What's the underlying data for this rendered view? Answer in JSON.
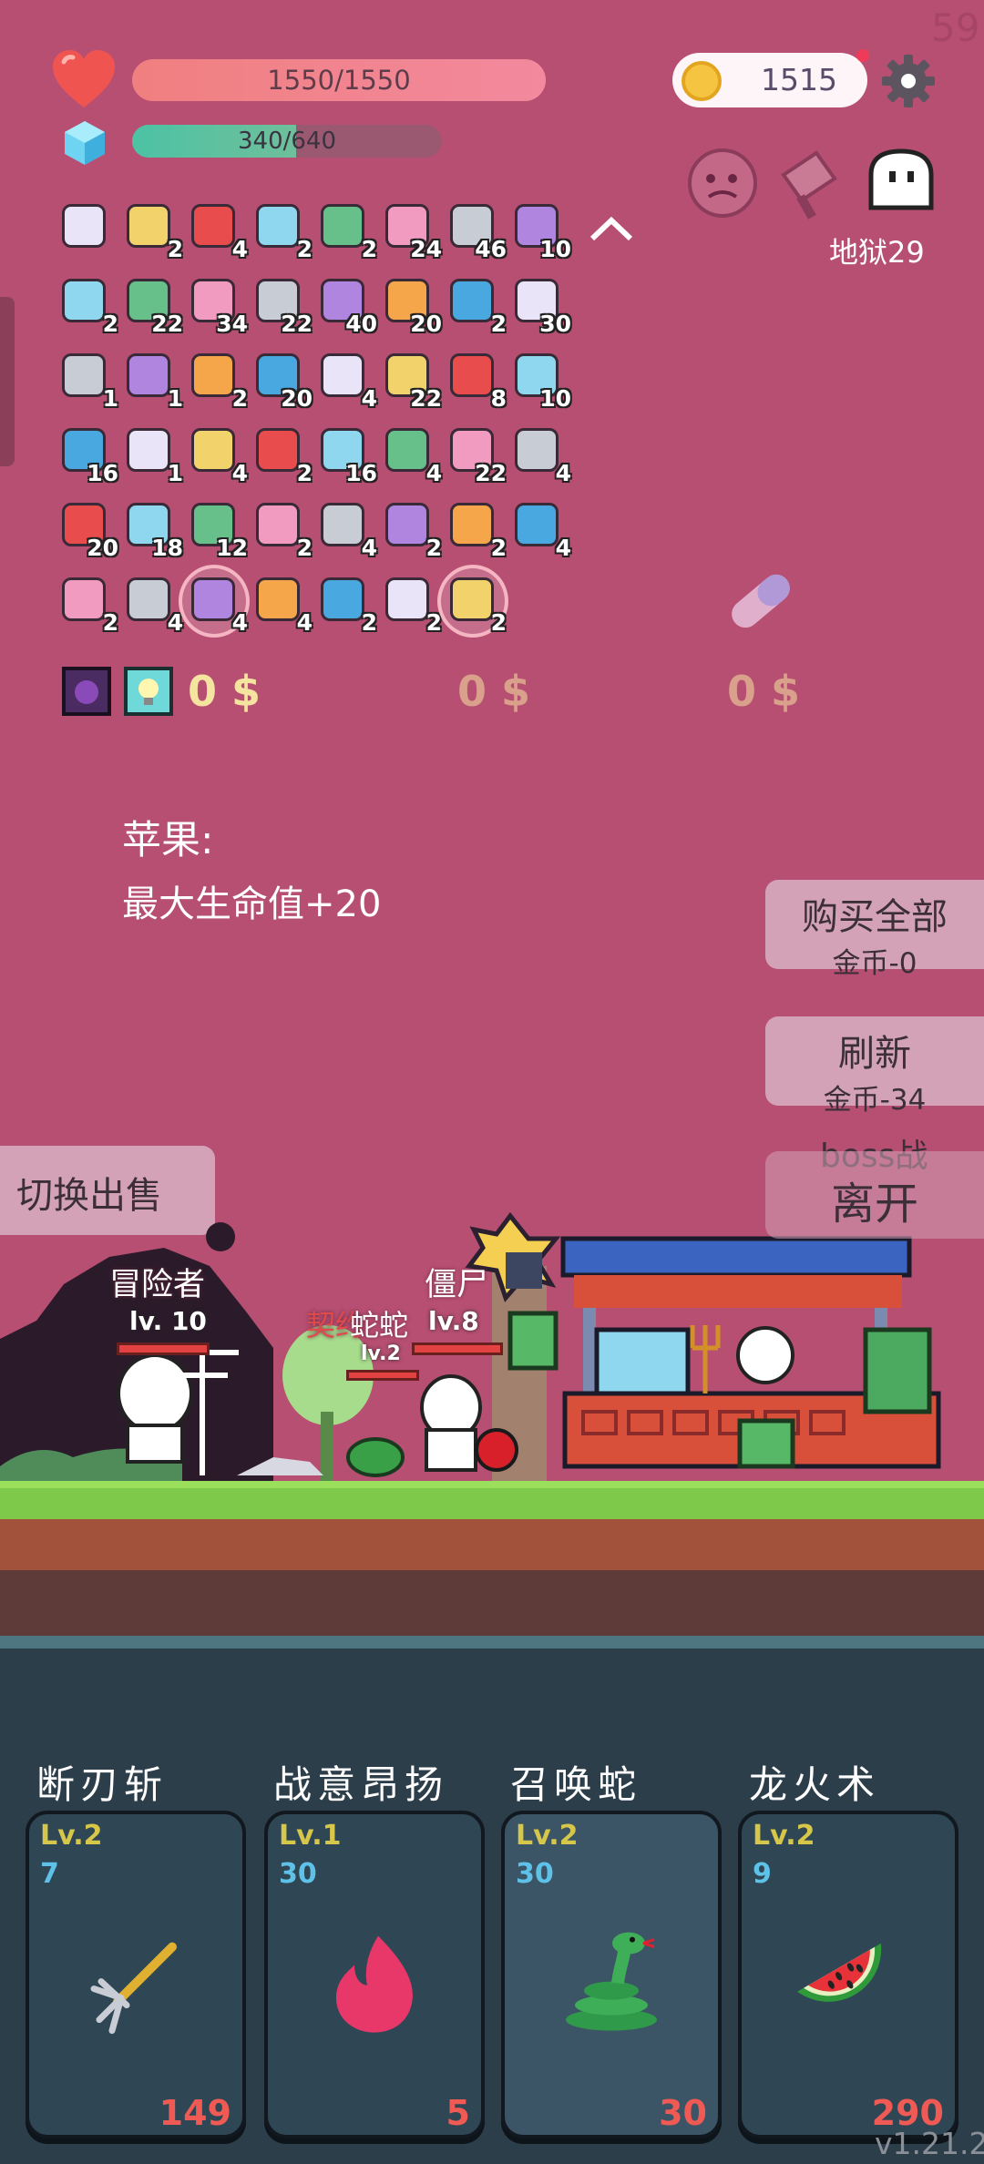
{
  "fps": "59",
  "hp": {
    "text": "1550/1550"
  },
  "mp": {
    "text": "340/640",
    "fraction": 0.53
  },
  "coins": {
    "amount": "1515"
  },
  "dungeon": {
    "label": "地狱29"
  },
  "inventory": [
    [
      {
        "icon": "tv-icon",
        "count": ""
      },
      {
        "icon": "tv-icon",
        "count": "2"
      },
      {
        "icon": "biohazard-icon",
        "count": "4"
      },
      {
        "icon": "tv-icon",
        "count": "2"
      },
      {
        "icon": "snake-icon",
        "count": "2"
      },
      {
        "icon": "beer-icon",
        "count": "24"
      },
      {
        "icon": "sword-icon",
        "count": "46"
      },
      {
        "icon": "dagger-icon",
        "count": "10"
      }
    ],
    [
      {
        "icon": "crystal-ball-icon",
        "count": "2"
      },
      {
        "icon": "shield-icon",
        "count": "22"
      },
      {
        "icon": "apple-icon",
        "count": "34"
      },
      {
        "icon": "thermometer-icon",
        "count": "22"
      },
      {
        "icon": "watermelon-icon",
        "count": "40"
      },
      {
        "icon": "potion-icon",
        "count": "20"
      },
      {
        "icon": "briefcase-icon",
        "count": "2"
      },
      {
        "icon": "book-icon",
        "count": "30"
      }
    ],
    [
      {
        "icon": "map-icon",
        "count": "1"
      },
      {
        "icon": "dice-icon",
        "count": "1"
      },
      {
        "icon": "ice-cream-icon",
        "count": "2"
      },
      {
        "icon": "pill-icon",
        "count": "20"
      },
      {
        "icon": "jam-icon",
        "count": "4"
      },
      {
        "icon": "capsule-icon",
        "count": "22"
      },
      {
        "icon": "tombstone-icon",
        "count": "8"
      },
      {
        "icon": "blade-icon",
        "count": "10"
      }
    ],
    [
      {
        "icon": "flower-icon",
        "count": "16"
      },
      {
        "icon": "treasure-map-icon",
        "count": "1"
      },
      {
        "icon": "egg-icon",
        "count": "4"
      },
      {
        "icon": "molecule-icon",
        "count": "2"
      },
      {
        "icon": "bow-icon",
        "count": "16"
      },
      {
        "icon": "coconut-icon",
        "count": "4"
      },
      {
        "icon": "chat-icon",
        "count": "22"
      },
      {
        "icon": "scroll-icon",
        "count": "4"
      }
    ],
    [
      {
        "icon": "flask-icon",
        "count": "20"
      },
      {
        "icon": "pineapple-icon",
        "count": "18"
      },
      {
        "icon": "sunflower-icon",
        "count": "12"
      },
      {
        "icon": "cards-icon",
        "count": "2"
      },
      {
        "icon": "tulip-icon",
        "count": "4"
      },
      {
        "icon": "bulb-icon",
        "count": "2"
      },
      {
        "icon": "wizard-hat-icon",
        "count": "2"
      },
      {
        "icon": "star-card-icon",
        "count": "4"
      }
    ],
    [
      {
        "icon": "target-icon",
        "count": "2"
      },
      {
        "icon": "shirt-icon",
        "count": "4"
      },
      {
        "icon": "apple-big-icon",
        "count": "4"
      },
      {
        "icon": "axe-icon",
        "count": "4"
      },
      {
        "icon": "heat-icon",
        "count": "2"
      },
      {
        "icon": "strawberry-icon",
        "count": "2"
      },
      {
        "icon": "compass-icon",
        "count": "2"
      }
    ]
  ],
  "shop_prices": [
    "0 $",
    "0 $",
    "0 $"
  ],
  "description": {
    "title": "苹果:",
    "effect": "最大生命值+20"
  },
  "buttons": {
    "buy_all": "购买全部",
    "buy_all_cost": "金币-0",
    "refresh": "刷新",
    "refresh_cost": "金币-34",
    "boss": "boss战",
    "leave": "离开",
    "switch_sell": "切换出售"
  },
  "scene": {
    "player_name": "冒险者",
    "player_lv": "lv. 10",
    "pet_name": "蛇蛇",
    "pet_prefix": "契约",
    "pet_lv": "lv.2",
    "enemy_name": "僵尸",
    "enemy_lv": "lv.8"
  },
  "skills": [
    {
      "name": "断刃斩",
      "level": "Lv.2",
      "cost": "7",
      "damage": "149",
      "icon": "trident-icon"
    },
    {
      "name": "战意昂扬",
      "level": "Lv.1",
      "cost": "30",
      "damage": "5",
      "icon": "flame-icon"
    },
    {
      "name": "召唤蛇",
      "level": "Lv.2",
      "cost": "30",
      "damage": "30",
      "icon": "snake-icon"
    },
    {
      "name": "龙火术",
      "level": "Lv.2",
      "cost": "9",
      "damage": "290",
      "icon": "watermelon-icon"
    }
  ],
  "version": "v1.21.2",
  "colors": {
    "background": "#b74f72",
    "hp": "#f07f7f",
    "mp": "#4cc3a4",
    "card": "#2f4654"
  }
}
